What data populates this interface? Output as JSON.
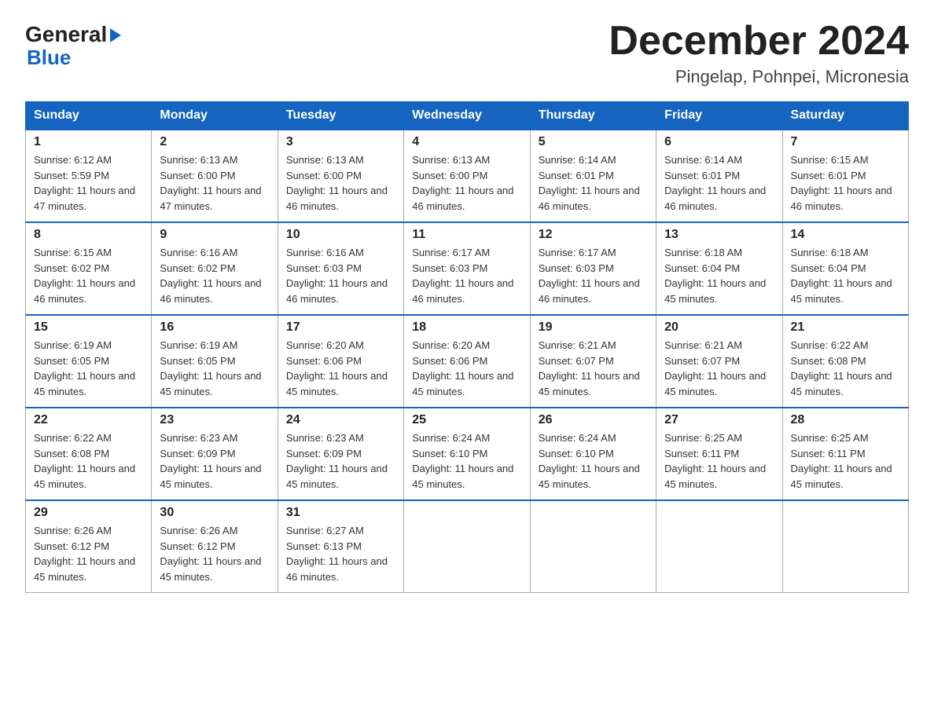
{
  "header": {
    "logo_general": "General",
    "logo_blue": "Blue",
    "month": "December 2024",
    "location": "Pingelap, Pohnpei, Micronesia"
  },
  "days_of_week": [
    "Sunday",
    "Monday",
    "Tuesday",
    "Wednesday",
    "Thursday",
    "Friday",
    "Saturday"
  ],
  "weeks": [
    [
      {
        "day": "1",
        "sunrise": "6:12 AM",
        "sunset": "5:59 PM",
        "daylight": "11 hours and 47 minutes."
      },
      {
        "day": "2",
        "sunrise": "6:13 AM",
        "sunset": "6:00 PM",
        "daylight": "11 hours and 47 minutes."
      },
      {
        "day": "3",
        "sunrise": "6:13 AM",
        "sunset": "6:00 PM",
        "daylight": "11 hours and 46 minutes."
      },
      {
        "day": "4",
        "sunrise": "6:13 AM",
        "sunset": "6:00 PM",
        "daylight": "11 hours and 46 minutes."
      },
      {
        "day": "5",
        "sunrise": "6:14 AM",
        "sunset": "6:01 PM",
        "daylight": "11 hours and 46 minutes."
      },
      {
        "day": "6",
        "sunrise": "6:14 AM",
        "sunset": "6:01 PM",
        "daylight": "11 hours and 46 minutes."
      },
      {
        "day": "7",
        "sunrise": "6:15 AM",
        "sunset": "6:01 PM",
        "daylight": "11 hours and 46 minutes."
      }
    ],
    [
      {
        "day": "8",
        "sunrise": "6:15 AM",
        "sunset": "6:02 PM",
        "daylight": "11 hours and 46 minutes."
      },
      {
        "day": "9",
        "sunrise": "6:16 AM",
        "sunset": "6:02 PM",
        "daylight": "11 hours and 46 minutes."
      },
      {
        "day": "10",
        "sunrise": "6:16 AM",
        "sunset": "6:03 PM",
        "daylight": "11 hours and 46 minutes."
      },
      {
        "day": "11",
        "sunrise": "6:17 AM",
        "sunset": "6:03 PM",
        "daylight": "11 hours and 46 minutes."
      },
      {
        "day": "12",
        "sunrise": "6:17 AM",
        "sunset": "6:03 PM",
        "daylight": "11 hours and 46 minutes."
      },
      {
        "day": "13",
        "sunrise": "6:18 AM",
        "sunset": "6:04 PM",
        "daylight": "11 hours and 45 minutes."
      },
      {
        "day": "14",
        "sunrise": "6:18 AM",
        "sunset": "6:04 PM",
        "daylight": "11 hours and 45 minutes."
      }
    ],
    [
      {
        "day": "15",
        "sunrise": "6:19 AM",
        "sunset": "6:05 PM",
        "daylight": "11 hours and 45 minutes."
      },
      {
        "day": "16",
        "sunrise": "6:19 AM",
        "sunset": "6:05 PM",
        "daylight": "11 hours and 45 minutes."
      },
      {
        "day": "17",
        "sunrise": "6:20 AM",
        "sunset": "6:06 PM",
        "daylight": "11 hours and 45 minutes."
      },
      {
        "day": "18",
        "sunrise": "6:20 AM",
        "sunset": "6:06 PM",
        "daylight": "11 hours and 45 minutes."
      },
      {
        "day": "19",
        "sunrise": "6:21 AM",
        "sunset": "6:07 PM",
        "daylight": "11 hours and 45 minutes."
      },
      {
        "day": "20",
        "sunrise": "6:21 AM",
        "sunset": "6:07 PM",
        "daylight": "11 hours and 45 minutes."
      },
      {
        "day": "21",
        "sunrise": "6:22 AM",
        "sunset": "6:08 PM",
        "daylight": "11 hours and 45 minutes."
      }
    ],
    [
      {
        "day": "22",
        "sunrise": "6:22 AM",
        "sunset": "6:08 PM",
        "daylight": "11 hours and 45 minutes."
      },
      {
        "day": "23",
        "sunrise": "6:23 AM",
        "sunset": "6:09 PM",
        "daylight": "11 hours and 45 minutes."
      },
      {
        "day": "24",
        "sunrise": "6:23 AM",
        "sunset": "6:09 PM",
        "daylight": "11 hours and 45 minutes."
      },
      {
        "day": "25",
        "sunrise": "6:24 AM",
        "sunset": "6:10 PM",
        "daylight": "11 hours and 45 minutes."
      },
      {
        "day": "26",
        "sunrise": "6:24 AM",
        "sunset": "6:10 PM",
        "daylight": "11 hours and 45 minutes."
      },
      {
        "day": "27",
        "sunrise": "6:25 AM",
        "sunset": "6:11 PM",
        "daylight": "11 hours and 45 minutes."
      },
      {
        "day": "28",
        "sunrise": "6:25 AM",
        "sunset": "6:11 PM",
        "daylight": "11 hours and 45 minutes."
      }
    ],
    [
      {
        "day": "29",
        "sunrise": "6:26 AM",
        "sunset": "6:12 PM",
        "daylight": "11 hours and 45 minutes."
      },
      {
        "day": "30",
        "sunrise": "6:26 AM",
        "sunset": "6:12 PM",
        "daylight": "11 hours and 45 minutes."
      },
      {
        "day": "31",
        "sunrise": "6:27 AM",
        "sunset": "6:13 PM",
        "daylight": "11 hours and 46 minutes."
      },
      null,
      null,
      null,
      null
    ]
  ]
}
